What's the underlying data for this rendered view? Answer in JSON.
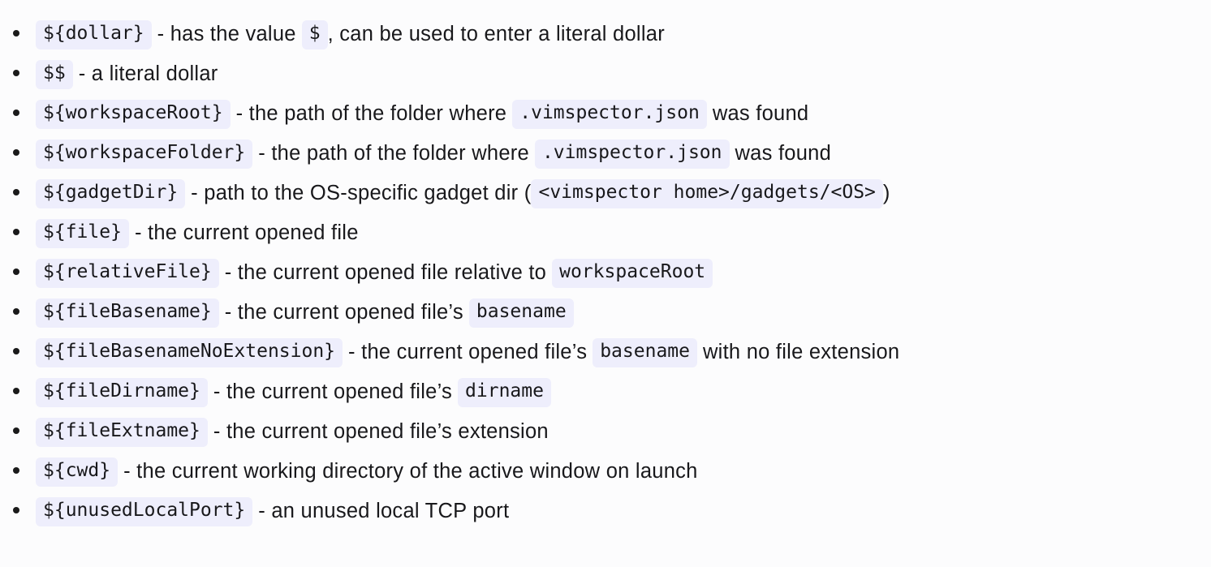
{
  "theme": {
    "page_background": "#fcfcfd",
    "text_color": "#18181b",
    "code_background": "#eeeefc",
    "code_text_color": "#18181b",
    "bullet_color": "#1a1a1a"
  },
  "list": {
    "items": [
      {
        "id": "dollar",
        "segments": [
          {
            "kind": "code",
            "text": "${dollar}"
          },
          {
            "kind": "text",
            "text": "- has the value"
          },
          {
            "kind": "code",
            "text": "$"
          },
          {
            "kind": "text",
            "text": ", can be used to enter a literal dollar",
            "tight_left": true
          }
        ]
      },
      {
        "id": "double-dollar",
        "segments": [
          {
            "kind": "code",
            "text": "$$"
          },
          {
            "kind": "text",
            "text": "- a literal dollar"
          }
        ]
      },
      {
        "id": "workspace-root",
        "segments": [
          {
            "kind": "code",
            "text": "${workspaceRoot}"
          },
          {
            "kind": "text",
            "text": "- the path of the folder where"
          },
          {
            "kind": "code",
            "text": ".vimspector.json"
          },
          {
            "kind": "text",
            "text": "was found"
          }
        ]
      },
      {
        "id": "workspace-folder",
        "segments": [
          {
            "kind": "code",
            "text": "${workspaceFolder}"
          },
          {
            "kind": "text",
            "text": "- the path of the folder where"
          },
          {
            "kind": "code",
            "text": ".vimspector.json"
          },
          {
            "kind": "text",
            "text": "was found"
          }
        ]
      },
      {
        "id": "gadget-dir",
        "segments": [
          {
            "kind": "code",
            "text": "${gadgetDir}"
          },
          {
            "kind": "text",
            "text": "- path to the OS-specific gadget dir (",
            "tight_right": true
          },
          {
            "kind": "code",
            "text": "<vimspector home>/gadgets/<OS>"
          },
          {
            "kind": "text",
            "text": ")",
            "tight_left": true
          }
        ]
      },
      {
        "id": "file",
        "segments": [
          {
            "kind": "code",
            "text": "${file}"
          },
          {
            "kind": "text",
            "text": "- the current opened file"
          }
        ]
      },
      {
        "id": "relative-file",
        "segments": [
          {
            "kind": "code",
            "text": "${relativeFile}"
          },
          {
            "kind": "text",
            "text": "- the current opened file relative to"
          },
          {
            "kind": "code",
            "text": "workspaceRoot"
          }
        ]
      },
      {
        "id": "file-basename",
        "segments": [
          {
            "kind": "code",
            "text": "${fileBasename}"
          },
          {
            "kind": "text",
            "text": "- the current opened file’s"
          },
          {
            "kind": "code",
            "text": "basename"
          }
        ]
      },
      {
        "id": "file-basename-no-extension",
        "segments": [
          {
            "kind": "code",
            "text": "${fileBasenameNoExtension}"
          },
          {
            "kind": "text",
            "text": "- the current opened file’s"
          },
          {
            "kind": "code",
            "text": "basename"
          },
          {
            "kind": "text",
            "text": "with no file extension"
          }
        ]
      },
      {
        "id": "file-dirname",
        "segments": [
          {
            "kind": "code",
            "text": "${fileDirname}"
          },
          {
            "kind": "text",
            "text": "- the current opened file’s"
          },
          {
            "kind": "code",
            "text": "dirname"
          }
        ]
      },
      {
        "id": "file-extname",
        "segments": [
          {
            "kind": "code",
            "text": "${fileExtname}"
          },
          {
            "kind": "text",
            "text": "- the current opened file’s extension"
          }
        ]
      },
      {
        "id": "cwd",
        "segments": [
          {
            "kind": "code",
            "text": "${cwd}"
          },
          {
            "kind": "text",
            "text": "- the current working directory of the active window on launch"
          }
        ]
      },
      {
        "id": "unused-local-port",
        "segments": [
          {
            "kind": "code",
            "text": "${unusedLocalPort}"
          },
          {
            "kind": "text",
            "text": "- an unused local TCP port"
          }
        ]
      }
    ]
  }
}
